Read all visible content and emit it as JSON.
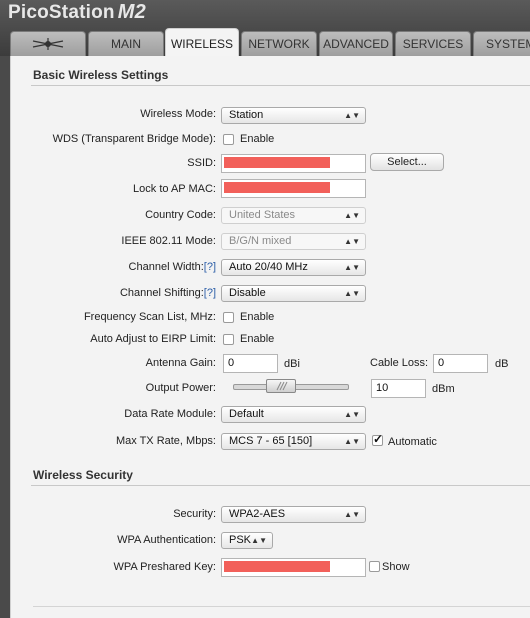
{
  "brand": {
    "name": "PicoStation",
    "model": "M2"
  },
  "tabs": [
    {
      "label": ""
    },
    {
      "label": "MAIN"
    },
    {
      "label": "WIRELESS"
    },
    {
      "label": "NETWORK"
    },
    {
      "label": "ADVANCED"
    },
    {
      "label": "SERVICES"
    },
    {
      "label": "SYSTEM"
    }
  ],
  "basic": {
    "title": "Basic Wireless Settings",
    "wireless_mode": {
      "label": "Wireless Mode:",
      "value": "Station"
    },
    "wds": {
      "label": "WDS (Transparent Bridge Mode):",
      "option": "Enable",
      "checked": false
    },
    "ssid": {
      "label": "SSID:",
      "select_button": "Select..."
    },
    "lock_ap": {
      "label": "Lock to AP MAC:"
    },
    "country": {
      "label": "Country Code:",
      "value": "United States"
    },
    "ieee": {
      "label": "IEEE 802.11 Mode:",
      "value": "B/G/N mixed"
    },
    "channel_width": {
      "label": "Channel Width:",
      "help": "[?]",
      "value": "Auto 20/40 MHz"
    },
    "channel_shifting": {
      "label": "Channel Shifting:",
      "help": "[?]",
      "value": "Disable"
    },
    "freq_scan": {
      "label": "Frequency Scan List, MHz:",
      "option": "Enable",
      "checked": false
    },
    "auto_adjust": {
      "label": "Auto Adjust to EIRP Limit:",
      "option": "Enable",
      "checked": false
    },
    "antenna_gain": {
      "label": "Antenna Gain:",
      "value": "0",
      "unit": "dBi"
    },
    "cable_loss": {
      "label": "Cable Loss:",
      "value": "0",
      "unit": "dB"
    },
    "output_power": {
      "label": "Output Power:",
      "value": "10",
      "unit": "dBm"
    },
    "data_rate": {
      "label": "Data Rate Module:",
      "value": "Default"
    },
    "max_tx": {
      "label": "Max TX Rate, Mbps:",
      "value": "MCS 7 - 65 [150]",
      "automatic_label": "Automatic",
      "automatic_checked": true
    }
  },
  "security": {
    "title": "Wireless Security",
    "security": {
      "label": "Security:",
      "value": "WPA2-AES"
    },
    "wpa_auth": {
      "label": "WPA Authentication:",
      "value": "PSK"
    },
    "psk": {
      "label": "WPA Preshared Key:",
      "show_label": "Show",
      "show_checked": false
    }
  },
  "colors": {
    "redaction": "#f2605a",
    "help_link": "#2d5fa8"
  }
}
